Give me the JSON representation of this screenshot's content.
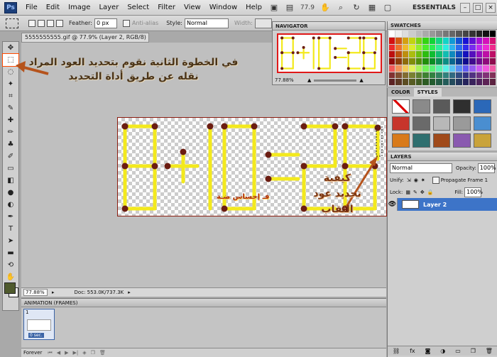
{
  "app": {
    "logo": "Ps",
    "zoom": "77.9",
    "workspace": "ESSENTIALS"
  },
  "menu": [
    "File",
    "Edit",
    "Image",
    "Layer",
    "Select",
    "Filter",
    "View",
    "Window",
    "Help"
  ],
  "options": {
    "feather_label": "Feather:",
    "feather_value": "0 px",
    "antialias_label": "Anti-alias",
    "style_label": "Style:",
    "style_value": "Normal",
    "width_label": "Width:"
  },
  "document": {
    "tab_title": "5555555555.gif @ 77.9% (Layer 2, RGB/8) *",
    "zoom": "77.88%",
    "doc_size": "Doc: 553.0K/737.3K"
  },
  "equation": {
    "text": "8+10=28"
  },
  "annotations": {
    "step_text": "في الخطوة الثانية نقوم بتحديد العود المراد نقله عن طريق أداة التحديد",
    "howto_text": "كيفية تحديد عود الثقاب",
    "signature": "فـ إحساس ضـة"
  },
  "navigator": {
    "title": "NAVIGATOR",
    "zoom": "77.88%"
  },
  "swatches": {
    "title": "SWATCHES"
  },
  "color_styles": {
    "tab_color": "COLOR",
    "tab_styles": "STYLES"
  },
  "layers": {
    "title": "LAYERS",
    "blend_mode": "Normal",
    "opacity_label": "Opacity:",
    "opacity_value": "100%",
    "unify_label": "Unify:",
    "propagate_label": "Propagate Frame 1",
    "lock_label": "Lock:",
    "fill_label": "Fill:",
    "fill_value": "100%",
    "layer_name": "Layer 2"
  },
  "animation": {
    "title": "ANIMATION (FRAMES)",
    "frame_number": "1",
    "frame_time": "0 sec.",
    "loop": "Forever"
  },
  "colors": {
    "foreground": "#4f5a2d",
    "background": "#ffffff",
    "matchstick": "#f3e91d",
    "match_head": "#6b1d12",
    "annotation_arrow": "#b5531c",
    "selection_accent": "#3d74c8"
  }
}
